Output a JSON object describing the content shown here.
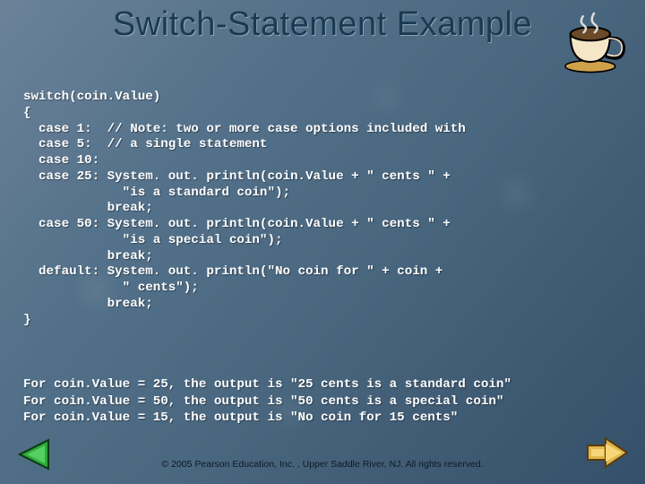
{
  "title": "Switch-Statement Example",
  "decor": {
    "teacup_alt": "teacup-illustration"
  },
  "code_lines": [
    "switch(coin.Value)",
    "{",
    "  case 1:  // Note: two or more case options included with",
    "  case 5:  // a single statement",
    "  case 10:",
    "  case 25: System. out. println(coin.Value + \" cents \" +",
    "             \"is a standard coin\");",
    "           break;",
    "  case 50: System. out. println(coin.Value + \" cents \" +",
    "             \"is a special coin\");",
    "           break;",
    "  default: System. out. println(\"No coin for \" + coin +",
    "             \" cents\");",
    "           break;",
    "}"
  ],
  "example_lines": [
    "For coin.Value = 25, the output is \"25 cents is a standard coin\"",
    "For coin.Value = 50, the output is \"50 cents is a special coin\"",
    "For coin.Value = 15, the output is \"No coin for 15 cents\""
  ],
  "footer": "© 2005 Pearson Education, Inc. , Upper Saddle River, NJ.  All rights reserved.",
  "nav": {
    "prev_alt": "previous-slide",
    "next_alt": "next-slide"
  }
}
